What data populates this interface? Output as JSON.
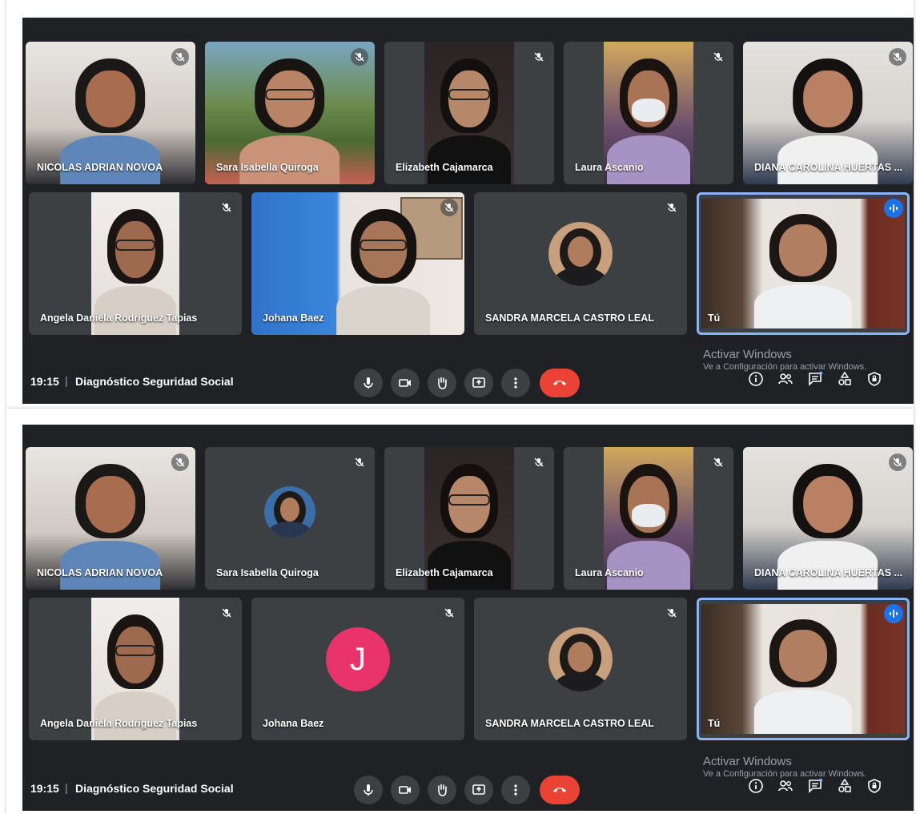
{
  "screens": [
    {
      "clock": "19:15",
      "separator": "|",
      "meeting_title": "Diagnóstico Seguridad Social",
      "watermark_line1": "Activar Windows",
      "watermark_line2": "Ve a Configuración para activar Windows.",
      "tiles": [
        {
          "name": "NICOLAS ADRIAN NOVOA",
          "muted": true,
          "mode": "video"
        },
        {
          "name": "Sara Isabella Quiroga",
          "muted": true,
          "mode": "video"
        },
        {
          "name": "Elizabeth Cajamarca",
          "muted": true,
          "mode": "video"
        },
        {
          "name": "Laura Ascanio",
          "muted": true,
          "mode": "video"
        },
        {
          "name": "DIANA CAROLINA HUERTAS ...",
          "muted": true,
          "mode": "video"
        },
        {
          "name": "Angela Daniela Rodriguez Tapias",
          "muted": true,
          "mode": "video"
        },
        {
          "name": "Johana Baez",
          "muted": true,
          "mode": "video"
        },
        {
          "name": "SANDRA MARCELA CASTRO LEAL",
          "muted": true,
          "mode": "avatar-photo"
        },
        {
          "name": "Tú",
          "muted": false,
          "mode": "video",
          "speaking": true
        }
      ]
    },
    {
      "clock": "19:15",
      "separator": "|",
      "meeting_title": "Diagnóstico Seguridad Social",
      "watermark_line1": "Activar Windows",
      "watermark_line2": "Ve a Configuración para activar Windows.",
      "tiles": [
        {
          "name": "NICOLAS ADRIAN NOVOA",
          "muted": true,
          "mode": "video"
        },
        {
          "name": "Sara Isabella Quiroga",
          "muted": true,
          "mode": "avatar-photo"
        },
        {
          "name": "Elizabeth Cajamarca",
          "muted": true,
          "mode": "video"
        },
        {
          "name": "Laura Ascanio",
          "muted": true,
          "mode": "video"
        },
        {
          "name": "DIANA CAROLINA HUERTAS ...",
          "muted": true,
          "mode": "video"
        },
        {
          "name": "Angela Daniela Rodriguez Tapias",
          "muted": true,
          "mode": "video"
        },
        {
          "name": "Johana Baez",
          "muted": true,
          "mode": "avatar-letter",
          "avatar_letter": "J",
          "avatar_color": "#e8336b"
        },
        {
          "name": "SANDRA MARCELA CASTRO LEAL",
          "muted": true,
          "mode": "avatar-photo"
        },
        {
          "name": "Tú",
          "muted": false,
          "mode": "video",
          "speaking": true
        }
      ]
    }
  ],
  "controls": [
    "microphone-icon",
    "camera-icon",
    "raise-hand-icon",
    "present-screen-icon",
    "more-options-icon",
    "end-call-icon"
  ],
  "right_controls": [
    "info-icon",
    "people-icon",
    "chat-icon",
    "activities-icon",
    "host-controls-icon"
  ],
  "colors": {
    "background": "#202124",
    "tile": "#3c4043",
    "end_call": "#ea4335",
    "speaking": "#8ab4f8",
    "accent": "#1a73e8"
  }
}
